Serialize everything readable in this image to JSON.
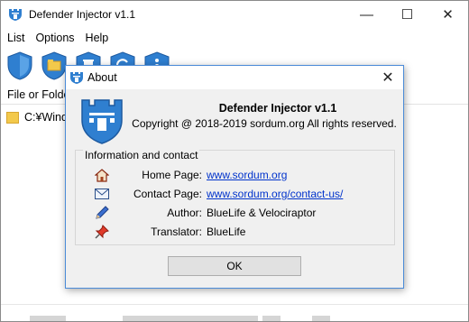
{
  "main_window": {
    "title": "Defender Injector v1.1",
    "controls": {
      "minimize": "—",
      "maximize": "☐",
      "close": "✕"
    },
    "menu": [
      "List",
      "Options",
      "Help"
    ],
    "toolbar_icons": [
      "shield-icon",
      "folder-shield-icon",
      "trash-shield-icon",
      "refresh-shield-icon",
      "info-shield-icon"
    ],
    "list_header": "File or Folde",
    "list_rows": [
      {
        "path": "C:¥Windo"
      }
    ]
  },
  "about_dialog": {
    "title": "About",
    "close": "✕",
    "app_name": "Defender Injector v1.1",
    "copyright": "Copyright @ 2018-2019 sordum.org All rights reserved.",
    "info_group_title": "Information and contact",
    "rows": [
      {
        "icon": "home-icon",
        "label": "Home Page:",
        "value": "www.sordum.org",
        "link": true
      },
      {
        "icon": "mail-icon",
        "label": "Contact Page:",
        "value": "www.sordum.org/contact-us/",
        "link": true
      },
      {
        "icon": "pencil-icon",
        "label": "Author:",
        "value": "BlueLife & Velociraptor",
        "link": false
      },
      {
        "icon": "pin-icon",
        "label": "Translator:",
        "value": "BlueLife",
        "link": false
      }
    ],
    "ok_label": "OK"
  },
  "colors": {
    "accent": "#2f7fd0",
    "link": "#0033cc",
    "dialog_border": "#4b8bd8"
  }
}
